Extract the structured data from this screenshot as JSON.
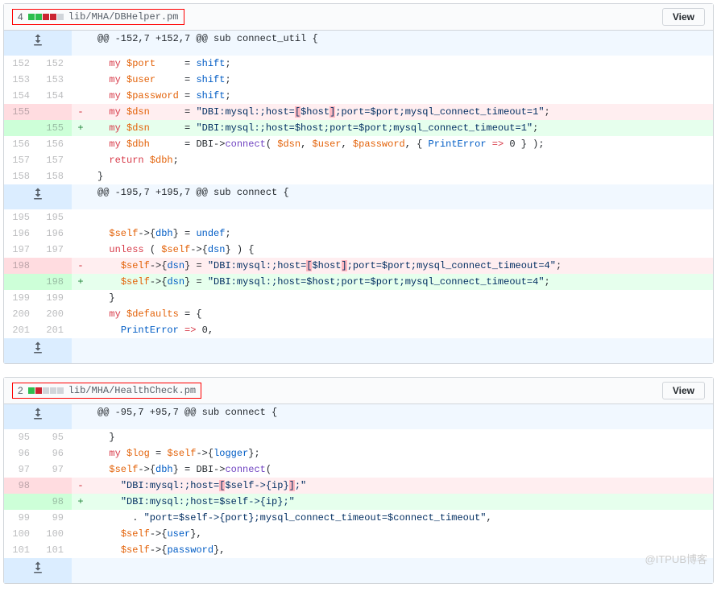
{
  "files": [
    {
      "changes": "4",
      "stat": [
        "add",
        "add",
        "del",
        "del",
        "neutral"
      ],
      "path": "lib/MHA/DBHelper.pm",
      "view": "View",
      "hunks": [
        {
          "header": "@@ -152,7 +152,7 @@ sub connect_util {",
          "expand_before": true,
          "lines": [
            {
              "t": "ctx",
              "ol": "152",
              "nl": "152",
              "html": "  <span class='pl-k'>my</span> <span class='pl-v'>$port</span>     = <span class='pl-c1'>shift</span>;"
            },
            {
              "t": "ctx",
              "ol": "153",
              "nl": "153",
              "html": "  <span class='pl-k'>my</span> <span class='pl-v'>$user</span>     = <span class='pl-c1'>shift</span>;"
            },
            {
              "t": "ctx",
              "ol": "154",
              "nl": "154",
              "html": "  <span class='pl-k'>my</span> <span class='pl-v'>$password</span> = <span class='pl-c1'>shift</span>;"
            },
            {
              "t": "del",
              "ol": "155",
              "nl": "",
              "html": "  <span class='pl-k'>my</span> <span class='pl-v'>$dsn</span>      = <span class='pl-s'>\"DBI:mysql:;host=<span class='hl-del'>[</span>$host<span class='hl-del'>]</span>;port=$port;mysql_connect_timeout=1\"</span>;"
            },
            {
              "t": "add",
              "ol": "",
              "nl": "155",
              "html": "  <span class='pl-k'>my</span> <span class='pl-v'>$dsn</span>      = <span class='pl-s'>\"DBI:mysql:;host=$host;port=$port;mysql_connect_timeout=1\"</span>;"
            },
            {
              "t": "ctx",
              "ol": "156",
              "nl": "156",
              "html": "  <span class='pl-k'>my</span> <span class='pl-v'>$dbh</span>      = DBI-&gt;<span class='pl-en'>connect</span>( <span class='pl-v'>$dsn</span>, <span class='pl-v'>$user</span>, <span class='pl-v'>$password</span>, { <span class='pl-c1'>PrintError</span> <span class='pl-k'>=&gt;</span> 0 } );"
            },
            {
              "t": "ctx",
              "ol": "157",
              "nl": "157",
              "html": "  <span class='pl-k'>return</span> <span class='pl-v'>$dbh</span>;"
            },
            {
              "t": "ctx",
              "ol": "158",
              "nl": "158",
              "html": "}"
            }
          ]
        },
        {
          "header": "@@ -195,7 +195,7 @@ sub connect {",
          "expand_before": true,
          "expand_after": true,
          "lines": [
            {
              "t": "ctx",
              "ol": "195",
              "nl": "195",
              "html": ""
            },
            {
              "t": "ctx",
              "ol": "196",
              "nl": "196",
              "html": "  <span class='pl-v'>$self</span>-&gt;{<span class='pl-c1'>dbh</span>} = <span class='pl-c1'>undef</span>;"
            },
            {
              "t": "ctx",
              "ol": "197",
              "nl": "197",
              "html": "  <span class='pl-k'>unless</span> ( <span class='pl-v'>$self</span>-&gt;{<span class='pl-c1'>dsn</span>} ) {"
            },
            {
              "t": "del",
              "ol": "198",
              "nl": "",
              "html": "    <span class='pl-v'>$self</span>-&gt;{<span class='pl-c1'>dsn</span>} = <span class='pl-s'>\"DBI:mysql:;host=<span class='hl-del'>[</span>$host<span class='hl-del'>]</span>;port=$port;mysql_connect_timeout=4\"</span>;"
            },
            {
              "t": "add",
              "ol": "",
              "nl": "198",
              "html": "    <span class='pl-v'>$self</span>-&gt;{<span class='pl-c1'>dsn</span>} = <span class='pl-s'>\"DBI:mysql:;host=$host;port=$port;mysql_connect_timeout=4\"</span>;"
            },
            {
              "t": "ctx",
              "ol": "199",
              "nl": "199",
              "html": "  }"
            },
            {
              "t": "ctx",
              "ol": "200",
              "nl": "200",
              "html": "  <span class='pl-k'>my</span> <span class='pl-v'>$defaults</span> = {"
            },
            {
              "t": "ctx",
              "ol": "201",
              "nl": "201",
              "html": "    <span class='pl-c1'>PrintError</span> <span class='pl-k'>=&gt;</span> 0,"
            }
          ]
        }
      ]
    },
    {
      "changes": "2",
      "stat": [
        "add",
        "del",
        "neutral",
        "neutral",
        "neutral"
      ],
      "path": "lib/MHA/HealthCheck.pm",
      "view": "View",
      "hunks": [
        {
          "header": "@@ -95,7 +95,7 @@ sub connect {",
          "expand_before": true,
          "expand_after": true,
          "lines": [
            {
              "t": "ctx",
              "ol": "95",
              "nl": "95",
              "html": "  }"
            },
            {
              "t": "ctx",
              "ol": "96",
              "nl": "96",
              "html": "  <span class='pl-k'>my</span> <span class='pl-v'>$log</span> = <span class='pl-v'>$self</span>-&gt;{<span class='pl-c1'>logger</span>};"
            },
            {
              "t": "ctx",
              "ol": "97",
              "nl": "97",
              "html": "  <span class='pl-v'>$self</span>-&gt;{<span class='pl-c1'>dbh</span>} = DBI-&gt;<span class='pl-en'>connect</span>("
            },
            {
              "t": "del",
              "ol": "98",
              "nl": "",
              "html": "    <span class='pl-s'>\"DBI:mysql:;host=<span class='hl-del'>[</span>$self-&gt;{ip}<span class='hl-del'>]</span>;\"</span>"
            },
            {
              "t": "add",
              "ol": "",
              "nl": "98",
              "html": "    <span class='pl-s'>\"DBI:mysql:;host=$self-&gt;{ip};\"</span>"
            },
            {
              "t": "ctx",
              "ol": "99",
              "nl": "99",
              "html": "      . <span class='pl-s'>\"port=$self-&gt;{port};mysql_connect_timeout=$connect_timeout\"</span>,"
            },
            {
              "t": "ctx",
              "ol": "100",
              "nl": "100",
              "html": "    <span class='pl-v'>$self</span>-&gt;{<span class='pl-c1'>user</span>},"
            },
            {
              "t": "ctx",
              "ol": "101",
              "nl": "101",
              "html": "    <span class='pl-v'>$self</span>-&gt;{<span class='pl-c1'>password</span>},"
            }
          ]
        }
      ]
    }
  ],
  "watermark": "@ITPUB博客"
}
